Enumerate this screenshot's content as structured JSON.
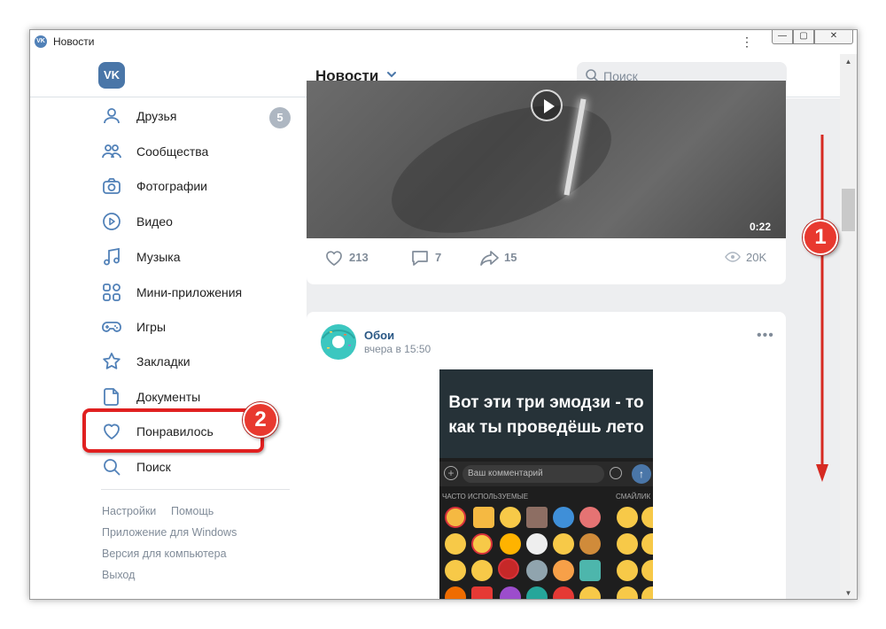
{
  "window": {
    "title": "Новости",
    "title_logo": "VK",
    "menu_icon": "⋮",
    "min_label": "—",
    "max_label": "▢",
    "close_label": "✕"
  },
  "header": {
    "logo": "VK",
    "title": "Новости",
    "search_placeholder": "Поиск"
  },
  "sidebar": {
    "items": [
      {
        "label": "Друзья",
        "icon": "user-icon",
        "badge": "5"
      },
      {
        "label": "Сообщества",
        "icon": "users-icon"
      },
      {
        "label": "Фотографии",
        "icon": "camera-icon"
      },
      {
        "label": "Видео",
        "icon": "play-circle-icon"
      },
      {
        "label": "Музыка",
        "icon": "music-note-icon"
      },
      {
        "label": "Мини-приложения",
        "icon": "apps-grid-icon"
      },
      {
        "label": "Игры",
        "icon": "gamepad-icon"
      },
      {
        "label": "Закладки",
        "icon": "star-icon"
      },
      {
        "label": "Документы",
        "icon": "document-icon"
      },
      {
        "label": "Понравилось",
        "icon": "heart-icon"
      },
      {
        "label": "Поиск",
        "icon": "search-icon"
      }
    ],
    "footer": {
      "settings": "Настройки",
      "help": "Помощь",
      "windows_app": "Приложение для Windows",
      "desktop_version": "Версия для компьютера",
      "logout": "Выход"
    }
  },
  "feed": {
    "video_post": {
      "duration": "0:22",
      "likes": "213",
      "comments": "7",
      "shares": "15",
      "views": "20K"
    },
    "post": {
      "author": "Обои",
      "time": "вчера в 15:50",
      "more": "•••",
      "image_caption_line1": "Вот эти три эмодзи - то",
      "image_caption_line2": "как ты проведёшь лето",
      "image_comment_placeholder": "Ваш комментарий",
      "image_section_frequent": "ЧАСТО ИСПОЛЬЗУЕМЫЕ",
      "image_section_smileys": "СМАЙЛИК"
    }
  },
  "annotations": {
    "marker1": "1",
    "marker2": "2",
    "color": "#e02020"
  },
  "colors": {
    "accent": "#4a76a8",
    "link": "#2a5885",
    "muted": "#818c99",
    "feed_bg": "#edeef0"
  }
}
